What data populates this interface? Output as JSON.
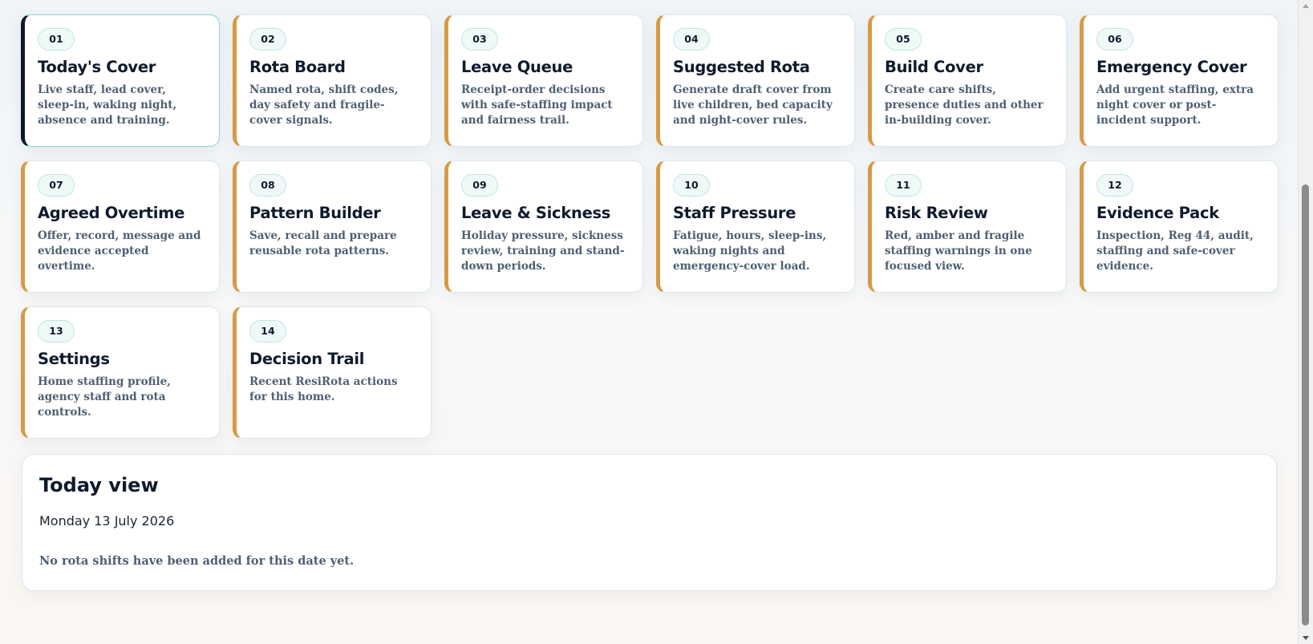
{
  "cards": [
    {
      "number": "01",
      "title": "Today's Cover",
      "description": "Live staff, lead cover, sleep-in, waking night, absence and training.",
      "active": true
    },
    {
      "number": "02",
      "title": "Rota Board",
      "description": "Named rota, shift codes, day safety and fragile-cover signals."
    },
    {
      "number": "03",
      "title": "Leave Queue",
      "description": "Receipt-order decisions with safe-staffing impact and fairness trail."
    },
    {
      "number": "04",
      "title": "Suggested Rota",
      "description": "Generate draft cover from live children, bed capacity and night-cover rules."
    },
    {
      "number": "05",
      "title": "Build Cover",
      "description": "Create care shifts, presence duties and other in-building cover."
    },
    {
      "number": "06",
      "title": "Emergency Cover",
      "description": "Add urgent staffing, extra night cover or post-incident support."
    },
    {
      "number": "07",
      "title": "Agreed Overtime",
      "description": "Offer, record, message and evidence accepted overtime."
    },
    {
      "number": "08",
      "title": "Pattern Builder",
      "description": "Save, recall and prepare reusable rota patterns."
    },
    {
      "number": "09",
      "title": "Leave & Sickness",
      "description": "Holiday pressure, sickness review, training and stand-down periods."
    },
    {
      "number": "10",
      "title": "Staff Pressure",
      "description": "Fatigue, hours, sleep-ins, waking nights and emergency-cover load."
    },
    {
      "number": "11",
      "title": "Risk Review",
      "description": "Red, amber and fragile staffing warnings in one focused view."
    },
    {
      "number": "12",
      "title": "Evidence Pack",
      "description": "Inspection, Reg 44, audit, staffing and safe-cover evidence."
    },
    {
      "number": "13",
      "title": "Settings",
      "description": "Home staffing profile, agency staff and rota controls."
    },
    {
      "number": "14",
      "title": "Decision Trail",
      "description": "Recent ResiRota actions for this home."
    }
  ],
  "today": {
    "title": "Today view",
    "date": "Monday 13 July 2026",
    "empty_message": "No rota shifts have been added for this date yet."
  },
  "colors": {
    "accent": "#d89a44",
    "active_accent": "#0e1a2b",
    "badge_bg": "#eef9f8",
    "muted_text": "#4f5f72"
  }
}
